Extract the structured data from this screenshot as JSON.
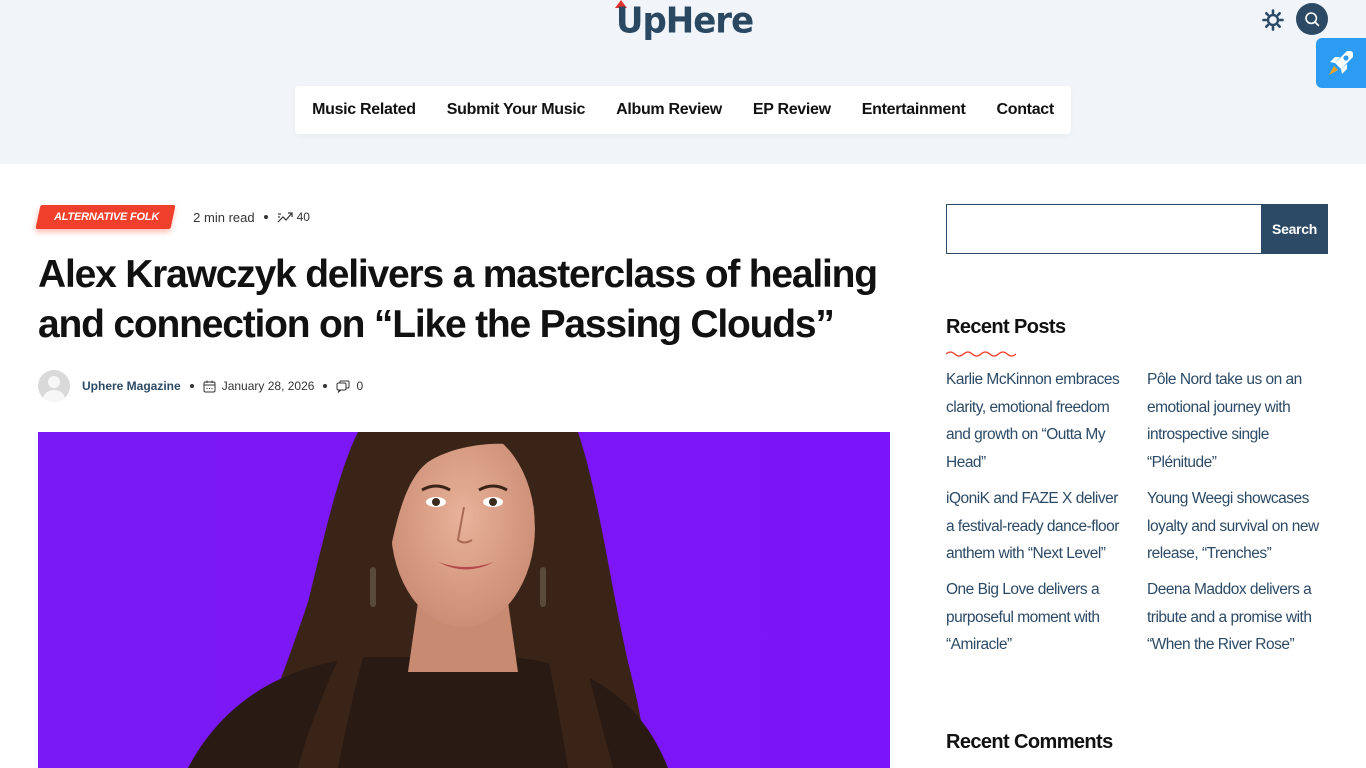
{
  "brand": {
    "logo_text": "UpHere"
  },
  "header_icons": {
    "theme": "sun-gear-icon",
    "search": "search-icon",
    "rocket": "rocket-icon"
  },
  "nav": {
    "items": [
      {
        "label": "Music Related"
      },
      {
        "label": "Submit Your Music"
      },
      {
        "label": "Album Review"
      },
      {
        "label": "EP Review"
      },
      {
        "label": "Entertainment"
      },
      {
        "label": "Contact"
      }
    ]
  },
  "article": {
    "category": "ALTERNATIVE FOLK",
    "read_time": "2 min read",
    "views": "40",
    "title": "Alex Krawczyk delivers a masterclass of healing and connection on “Like the Passing Clouds”",
    "author": "Uphere Magazine",
    "date": "January 28, 2026",
    "comments": "0"
  },
  "sidebar": {
    "search_placeholder": "",
    "search_button": "Search",
    "recent_posts_title": "Recent Posts",
    "recent_posts": [
      {
        "title": "Karlie McKinnon embraces clarity, emotional freedom and growth on “Outta My Head”"
      },
      {
        "title": "Pôle Nord take us on an emotional journey with introspective single “Plénitude”"
      },
      {
        "title": "iQoniK and FAZE X deliver a festival-ready dance-floor anthem with “Next Level”"
      },
      {
        "title": "Young Weegi showcases loyalty and survival on new release, “Trenches”"
      },
      {
        "title": "One Big Love delivers a purposeful moment with “Amiracle”"
      },
      {
        "title": "Deena Maddox delivers a tribute and a promise with “When the River Rose”"
      }
    ],
    "recent_comments_title": "Recent Comments"
  },
  "colors": {
    "accent": "#2c4a66",
    "category": "#f0402b",
    "hero_bg": "#7a19f5",
    "header_bg": "#f1f5fa",
    "rocket_bg": "#2b9cf2"
  }
}
